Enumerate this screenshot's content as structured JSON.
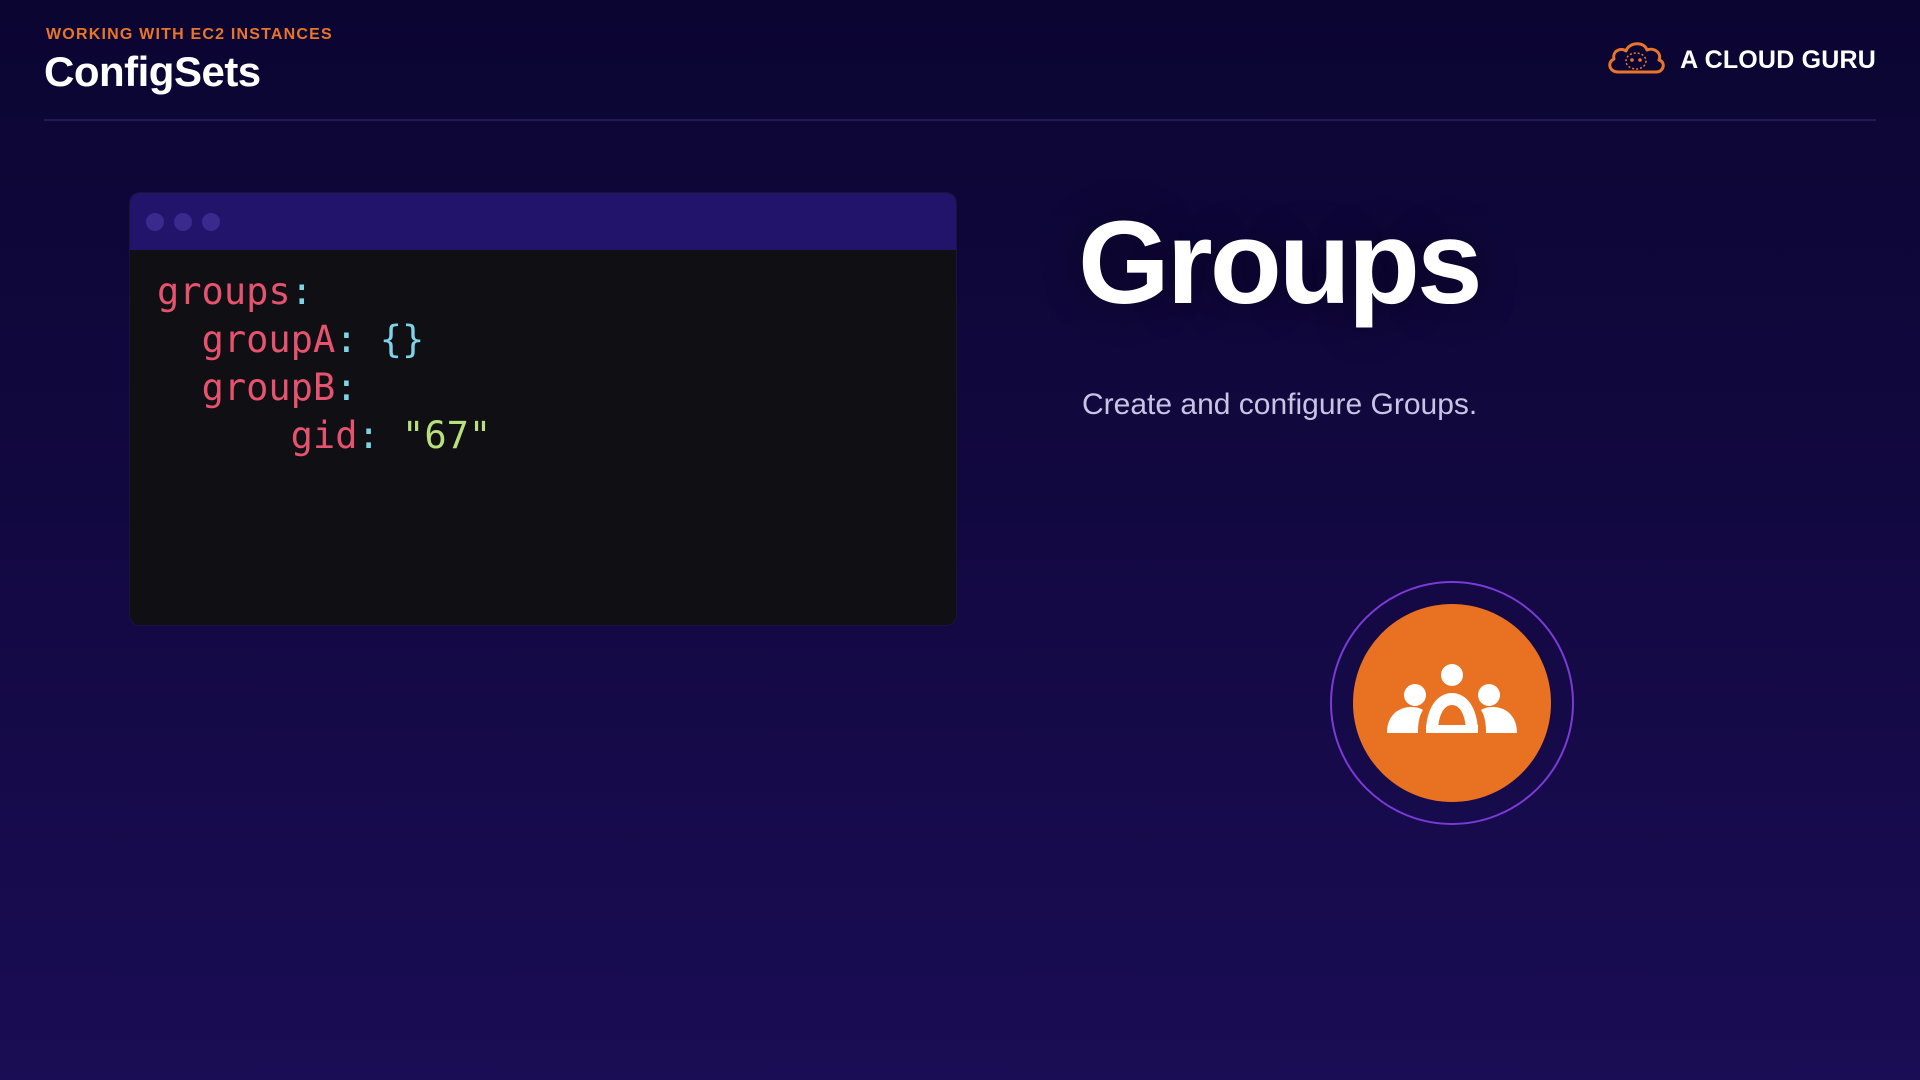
{
  "header": {
    "kicker": "WORKING WITH EC2 INSTANCES",
    "title": "ConfigSets",
    "logo_text": "A CLOUD GURU",
    "logo_icon": "cloud-icon"
  },
  "code": {
    "line1_key": "groups",
    "line2_key": "groupA",
    "line2_value": "{}",
    "line3_key": "groupB",
    "line4_key": "gid",
    "line4_value": "\"67\""
  },
  "feature": {
    "title": "Groups",
    "description": "Create and configure Groups.",
    "icon": "group-users-icon"
  },
  "colors": {
    "accent_orange": "#e87222",
    "ring_purple": "#7b3ad6",
    "background": "#120840"
  }
}
